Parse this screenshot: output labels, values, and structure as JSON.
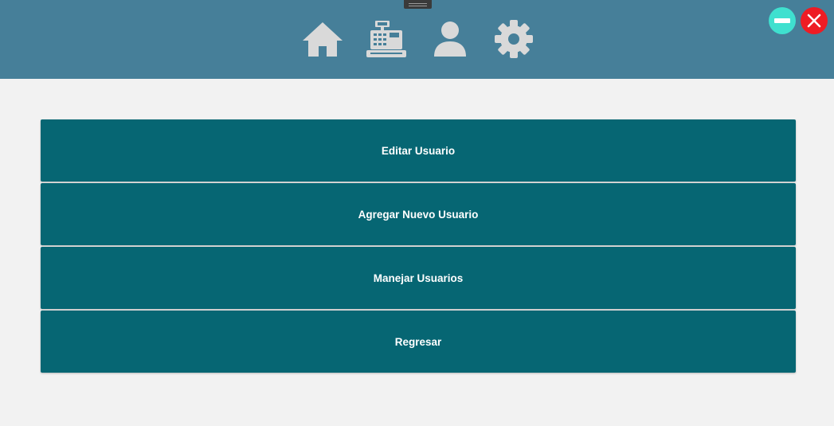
{
  "header": {
    "nav_icons": [
      "home-icon",
      "cash-register-icon",
      "user-icon",
      "gear-icon"
    ],
    "window_controls": [
      "minimize-icon",
      "close-icon"
    ]
  },
  "menu": {
    "items": [
      {
        "label": "Editar Usuario"
      },
      {
        "label": "Agregar Nuevo Usuario"
      },
      {
        "label": "Manejar Usuarios"
      },
      {
        "label": "Regresar"
      }
    ]
  },
  "colors": {
    "header_bg": "#467f99",
    "page_bg": "#f2f2f2",
    "button_bg": "#066673",
    "icon_fill": "#d9d9d9",
    "minimize": "#3fe0cf",
    "close": "#ee1c24"
  }
}
